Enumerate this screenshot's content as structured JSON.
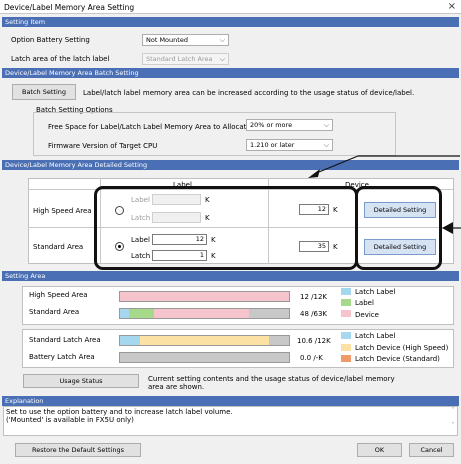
{
  "window": {
    "title": "Device/Label Memory Area Setting",
    "close": "×"
  },
  "setting_item": {
    "header": "Setting Item",
    "option_battery_label": "Option Battery Setting",
    "option_battery_value": "Not Mounted",
    "latch_area_label": "Latch area of the latch label",
    "latch_area_value": "Standard Latch Area"
  },
  "batch": {
    "header": "Device/Label Memory Area Batch Setting",
    "button": "Batch Setting",
    "description": "Label/latch label memory area can be increased according to the usage status of device/label.",
    "options_title": "Batch Setting Options",
    "free_space_label": "Free Space for Label/Latch Label Memory Area to Allocate",
    "free_space_value": "20% or more",
    "firmware_label": "Firmware Version of Target CPU",
    "firmware_value": "1.210 or later"
  },
  "detail": {
    "header": "Device/Label Memory Area Detailed Setting",
    "col_label": "Label",
    "col_device": "Device",
    "high_speed": {
      "name": "High Speed Area",
      "label_caption": "Label",
      "label_value": "",
      "label_unit": "K",
      "latch_caption": "Latch",
      "latch_value": "",
      "latch_unit": "K",
      "device_value": "12",
      "device_unit": "K",
      "detail_button": "Detailed Setting",
      "selected": false
    },
    "standard": {
      "name": "Standard Area",
      "label_caption": "Label",
      "label_value": "12",
      "label_unit": "K",
      "latch_caption": "Latch",
      "latch_value": "1",
      "latch_unit": "K",
      "device_value": "35",
      "device_unit": "K",
      "detail_button": "Detailed Setting",
      "selected": true
    }
  },
  "setting_area": {
    "header": "Setting Area",
    "high_speed_area": {
      "name": "High Speed Area",
      "usage": "12 /12K",
      "fill": 1.0
    },
    "standard_area": {
      "name": "Standard Area",
      "usage": "48 /63K",
      "label_frac": 0.054,
      "device_frac": 0.707
    },
    "legend1": {
      "latch_label": "Latch Label",
      "label": "Label",
      "device": "Device"
    },
    "standard_latch_area": {
      "name": "Standard Latch Area",
      "usage": "10.6 /12K",
      "latch_label_frac": 0.12,
      "latch_device_frac": 0.76
    },
    "battery_latch_area": {
      "name": "Battery Latch Area",
      "usage": "0.0 /-K"
    },
    "legend2": {
      "latch_label": "Latch Label",
      "latch_device_high": "Latch Device (High Speed)",
      "latch_device_std": "Latch Device (Standard)"
    },
    "usage_button": "Usage Status",
    "usage_desc": "Current setting contents and the usage status of device/label memory area are shown."
  },
  "explanation": {
    "header": "Explanation",
    "text1": "Set to use the option battery and to increase latch label volume.",
    "text2": "('Mounted' is available in FX5U only)"
  },
  "footer": {
    "restore": "Restore the Default Settings",
    "ok": "OK",
    "cancel": "Cancel"
  },
  "colors": {
    "header_bg": "#4a6fb4",
    "latch_label": "#a5d8ee",
    "label": "#a6d98a",
    "device": "#f6c4cc",
    "latch_device_high": "#fbe1a3",
    "latch_device_std": "#ee9a6a",
    "unused": "#c8c8c8"
  }
}
